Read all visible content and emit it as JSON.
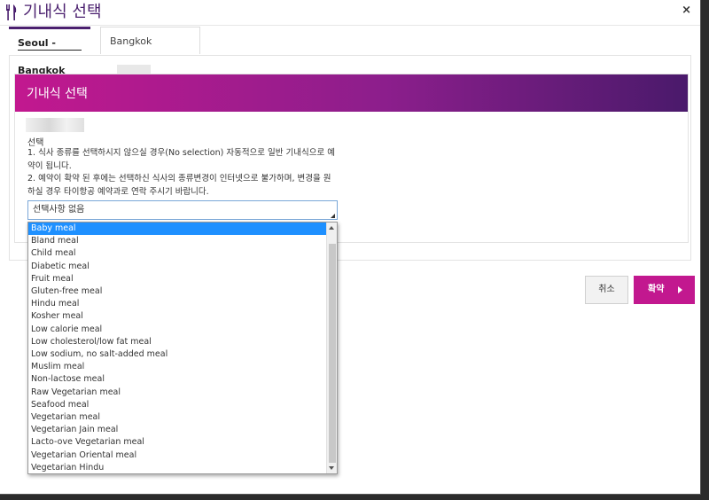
{
  "window": {
    "title": "기내식 선택",
    "close_label": "×"
  },
  "tabs": [
    {
      "label": "Seoul - Bangkok",
      "active": true
    },
    {
      "label": "Bangkok",
      "active": false
    }
  ],
  "section": {
    "banner_title": "기내식 선택",
    "select_label": "선택",
    "notice_1": "1. 식사 종류를 선택하시지 않으실 경우(No selection) 자동적으로 일반 기내식으로 예약이 됩니다.",
    "notice_2": "2. 예약이 확약 된 후에는 선택하신 식사의 종류변경이 인터넷으로 불가하며, 변경을 원하실 경우 타이항공 예약과로 연락 주시기 바랍니다.",
    "select_value": "선택사항 없음"
  },
  "buttons": {
    "cancel": "취소",
    "confirm": "확약"
  },
  "meal_options": [
    "Baby meal",
    "Bland meal",
    "Child meal",
    "Diabetic meal",
    "Fruit meal",
    "Gluten-free meal",
    "Hindu meal",
    "Kosher meal",
    "Low calorie meal",
    "Low cholesterol/low fat meal",
    "Low sodium, no salt-added meal",
    "Muslim meal",
    "Non-lactose meal",
    "Raw Vegetarian meal",
    "Seafood meal",
    "Vegetarian meal",
    "Vegetarian Jain meal",
    "Lacto-ove Vegetarian meal",
    "Vegetarian Oriental meal",
    "Vegetarian Hindu"
  ],
  "selected_option": "Baby meal",
  "colors": {
    "brand_purple": "#4a1f6e",
    "brand_magenta": "#c2188f",
    "selection_blue": "#1e90ff"
  }
}
